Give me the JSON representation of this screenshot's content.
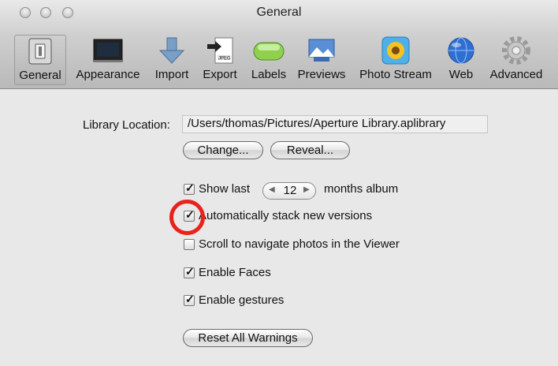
{
  "window": {
    "title": "General"
  },
  "toolbar": {
    "items": [
      {
        "label": "General",
        "icon": "switch-icon"
      },
      {
        "label": "Appearance",
        "icon": "monitor-icon"
      },
      {
        "label": "Import",
        "icon": "download-arrow-icon"
      },
      {
        "label": "Export",
        "icon": "jpeg-export-icon"
      },
      {
        "label": "Labels",
        "icon": "green-label-icon"
      },
      {
        "label": "Previews",
        "icon": "previews-icon"
      },
      {
        "label": "Photo Stream",
        "icon": "sunflower-icon"
      },
      {
        "label": "Web",
        "icon": "globe-icon"
      },
      {
        "label": "Advanced",
        "icon": "gear-icon"
      }
    ],
    "selected": "General"
  },
  "library": {
    "label": "Library Location:",
    "path": "/Users/thomas/Pictures/Aperture Library.aplibrary",
    "change_label": "Change...",
    "reveal_label": "Reveal..."
  },
  "options": {
    "show_last": {
      "label": "Show last",
      "checked": true,
      "value": "12",
      "suffix": "months album"
    },
    "auto_stack": {
      "label": "Automatically stack new versions",
      "checked": true
    },
    "scroll_nav": {
      "label": "Scroll to navigate photos in the Viewer",
      "checked": false
    },
    "faces": {
      "label": "Enable Faces",
      "checked": true
    },
    "gestures": {
      "label": "Enable gestures",
      "checked": true
    }
  },
  "reset_label": "Reset All Warnings",
  "highlight_color": "#e8231c"
}
